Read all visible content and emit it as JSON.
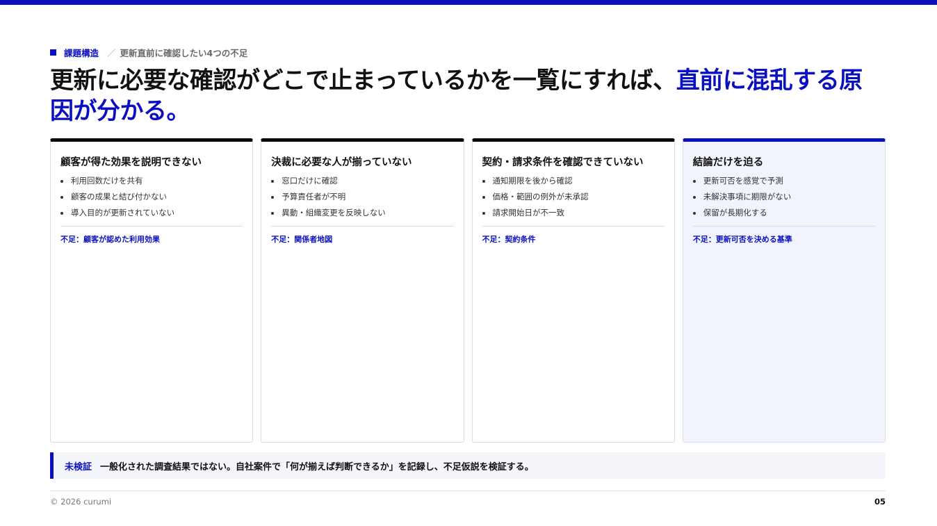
{
  "colors": {
    "accent": "#0a0fbf",
    "card_border_top": "#0a0a0a",
    "highlight_card_bg": "#f1f3fd",
    "callout_bg": "#f4f5fa"
  },
  "header": {
    "section_label": "課題構造",
    "separator": "／",
    "subtitle": "更新直前に確認したい4つの不足",
    "headline_main": "更新に必要な確認がどこで止まっているかを一覧にすれば、",
    "headline_accent": "直前に混乱する原因が分かる。"
  },
  "cards": [
    {
      "title": "顧客が得た効果を説明できない",
      "items": [
        "利用回数だけを共有",
        "顧客の成果と結び付かない",
        "導入目的が更新されていない"
      ],
      "note": "不足：顧客が認めた利用効果"
    },
    {
      "title": "決裁に必要な人が揃っていない",
      "items": [
        "窓口だけに確認",
        "予算責任者が不明",
        "異動・組織変更を反映しない"
      ],
      "note": "不足：関係者地図"
    },
    {
      "title": "契約・請求条件を確認できていない",
      "items": [
        "通知期限を後から確認",
        "価格・範囲の例外が未承認",
        "請求開始日が不一致"
      ],
      "note": "不足：契約条件"
    },
    {
      "title": "結論だけを迫る",
      "items": [
        "更新可否を感覚で予測",
        "未解決事項に期限がない",
        "保留が長期化する"
      ],
      "note": "不足：更新可否を決める基準"
    }
  ],
  "callout": {
    "tag": "未検証",
    "text": "一般化された調査結果ではない。自社案件で「何が揃えば判断できるか」を記録し、不足仮説を検証する。"
  },
  "footer": {
    "copyright": "© 2026 curumi",
    "page_number": "05"
  }
}
